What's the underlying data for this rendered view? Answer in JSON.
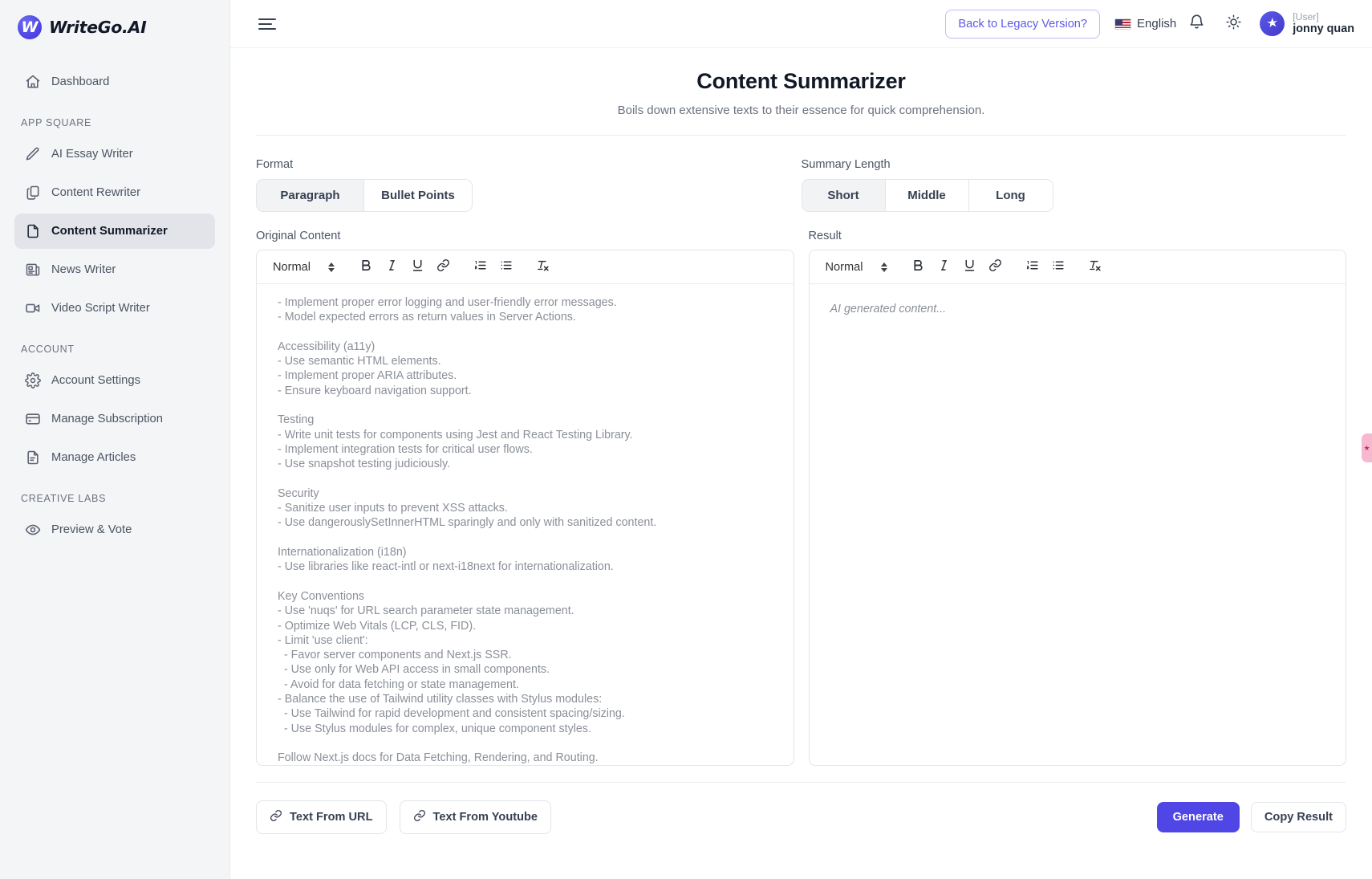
{
  "brand": {
    "name": "WriteGo.AI",
    "mark": "W"
  },
  "sidebar": {
    "groups": [
      {
        "label": "",
        "items": [
          {
            "label": "Dashboard",
            "icon": "home-icon",
            "active": false
          }
        ]
      },
      {
        "label": "APP SQUARE",
        "items": [
          {
            "label": "AI Essay Writer",
            "icon": "pencil-icon",
            "active": false
          },
          {
            "label": "Content Rewriter",
            "icon": "copy-icon",
            "active": false
          },
          {
            "label": "Content Summarizer",
            "icon": "file-icon",
            "active": true
          },
          {
            "label": "News Writer",
            "icon": "newspaper-icon",
            "active": false
          },
          {
            "label": "Video Script Writer",
            "icon": "video-icon",
            "active": false
          }
        ]
      },
      {
        "label": "ACCOUNT",
        "items": [
          {
            "label": "Account Settings",
            "icon": "gear-icon",
            "active": false
          },
          {
            "label": "Manage Subscription",
            "icon": "credit-card-icon",
            "active": false
          },
          {
            "label": "Manage Articles",
            "icon": "document-icon",
            "active": false
          }
        ]
      },
      {
        "label": "CREATIVE LABS",
        "items": [
          {
            "label": "Preview & Vote",
            "icon": "eye-icon",
            "active": false
          }
        ]
      }
    ]
  },
  "topbar": {
    "menu_icon": "hamburger-icon",
    "legacy_button": "Back to Legacy Version?",
    "language": "English",
    "flag": "us-flag",
    "notifications_icon": "bell-icon",
    "theme_icon": "sun-icon",
    "user_role": "[User]",
    "user_name": "jonny quan"
  },
  "page": {
    "title": "Content Summarizer",
    "subtitle": "Boils down extensive texts to their essence for quick comprehension."
  },
  "format": {
    "label": "Format",
    "options": [
      "Paragraph",
      "Bullet Points"
    ],
    "selected": "Paragraph"
  },
  "summary_length": {
    "label": "Summary Length",
    "options": [
      "Short",
      "Middle",
      "Long"
    ],
    "selected": "Short"
  },
  "original_editor": {
    "label": "Original Content",
    "toolbar": {
      "block_format": "Normal",
      "buttons": [
        "bold",
        "italic",
        "underline",
        "link",
        "ordered-list",
        "bullet-list",
        "clear-format"
      ]
    },
    "content": "- Implement proper error logging and user-friendly error messages.\n- Model expected errors as return values in Server Actions.\n\nAccessibility (a11y)\n- Use semantic HTML elements.\n- Implement proper ARIA attributes.\n- Ensure keyboard navigation support.\n\nTesting\n- Write unit tests for components using Jest and React Testing Library.\n- Implement integration tests for critical user flows.\n- Use snapshot testing judiciously.\n\nSecurity\n- Sanitize user inputs to prevent XSS attacks.\n- Use dangerouslySetInnerHTML sparingly and only with sanitized content.\n\nInternationalization (i18n)\n- Use libraries like react-intl or next-i18next for internationalization.\n\nKey Conventions\n- Use 'nuqs' for URL search parameter state management.\n- Optimize Web Vitals (LCP, CLS, FID).\n- Limit 'use client':\n  - Favor server components and Next.js SSR.\n  - Use only for Web API access in small components.\n  - Avoid for data fetching or state management.\n- Balance the use of Tailwind utility classes with Stylus modules:\n  - Use Tailwind for rapid development and consistent spacing/sizing.\n  - Use Stylus modules for complex, unique component styles.\n\nFollow Next.js docs for Data Fetching, Rendering, and Routing."
  },
  "result_editor": {
    "label": "Result",
    "toolbar": {
      "block_format": "Normal",
      "buttons": [
        "bold",
        "italic",
        "underline",
        "link",
        "ordered-list",
        "bullet-list",
        "clear-format"
      ]
    },
    "placeholder": "AI generated content..."
  },
  "footer": {
    "text_from_url": "Text From URL",
    "text_from_youtube": "Text From Youtube",
    "generate": "Generate",
    "copy_result": "Copy Result"
  },
  "colors": {
    "accent": "#4f46e5",
    "sidebar_bg": "#f4f5f7",
    "active_item_bg": "#e2e4e9",
    "text_muted": "#6b7280"
  }
}
